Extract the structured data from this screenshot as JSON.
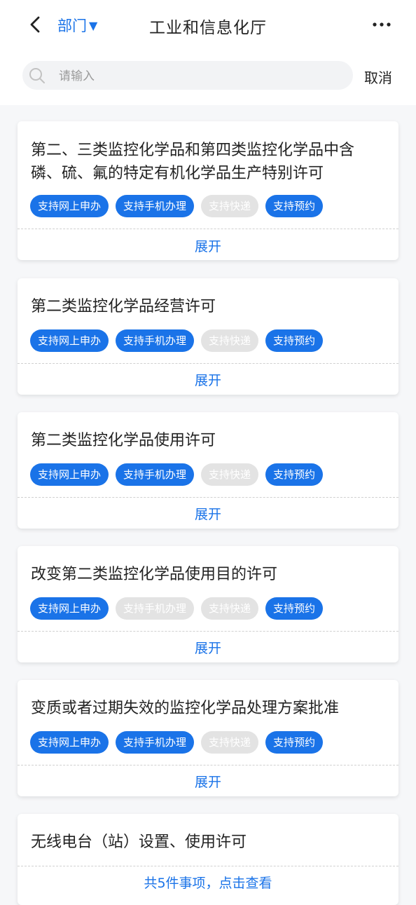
{
  "nav": {
    "dept_label": "部门",
    "dept_caret": "▼",
    "title": "工业和信息化厅"
  },
  "search": {
    "placeholder": "请输入",
    "cancel_label": "取消"
  },
  "items": [
    {
      "title": "第二、三类监控化学品和第四类监控化学品中含磷、硫、氟的特定有机化学品生产特别许可",
      "tags": [
        {
          "label": "支持网上申办",
          "active": true
        },
        {
          "label": "支持手机办理",
          "active": true
        },
        {
          "label": "支持快递",
          "active": false
        },
        {
          "label": "支持预约",
          "active": true
        }
      ],
      "action": "展开"
    },
    {
      "title": "第二类监控化学品经营许可",
      "tags": [
        {
          "label": "支持网上申办",
          "active": true
        },
        {
          "label": "支持手机办理",
          "active": true
        },
        {
          "label": "支持快递",
          "active": false
        },
        {
          "label": "支持预约",
          "active": true
        }
      ],
      "action": "展开"
    },
    {
      "title": "第二类监控化学品使用许可",
      "tags": [
        {
          "label": "支持网上申办",
          "active": true
        },
        {
          "label": "支持手机办理",
          "active": true
        },
        {
          "label": "支持快递",
          "active": false
        },
        {
          "label": "支持预约",
          "active": true
        }
      ],
      "action": "展开"
    },
    {
      "title": "改变第二类监控化学品使用目的许可",
      "tags": [
        {
          "label": "支持网上申办",
          "active": true
        },
        {
          "label": "支持手机办理",
          "active": false
        },
        {
          "label": "支持快递",
          "active": false
        },
        {
          "label": "支持预约",
          "active": true
        }
      ],
      "action": "展开"
    },
    {
      "title": "变质或者过期失效的监控化学品处理方案批准",
      "tags": [
        {
          "label": "支持网上申办",
          "active": true
        },
        {
          "label": "支持手机办理",
          "active": true
        },
        {
          "label": "支持快递",
          "active": false
        },
        {
          "label": "支持预约",
          "active": true
        }
      ],
      "action": "展开"
    },
    {
      "title": "无线电台（站）设置、使用许可",
      "tags": [],
      "action": "共5件事项，点击查看"
    }
  ],
  "colors": {
    "accent": "#1a73e8",
    "tag_inactive": "#e3e3e3",
    "background": "#f6f7f9"
  },
  "icons": {
    "back": "chevron-left-icon",
    "more": "more-dots-icon",
    "search": "search-icon"
  }
}
